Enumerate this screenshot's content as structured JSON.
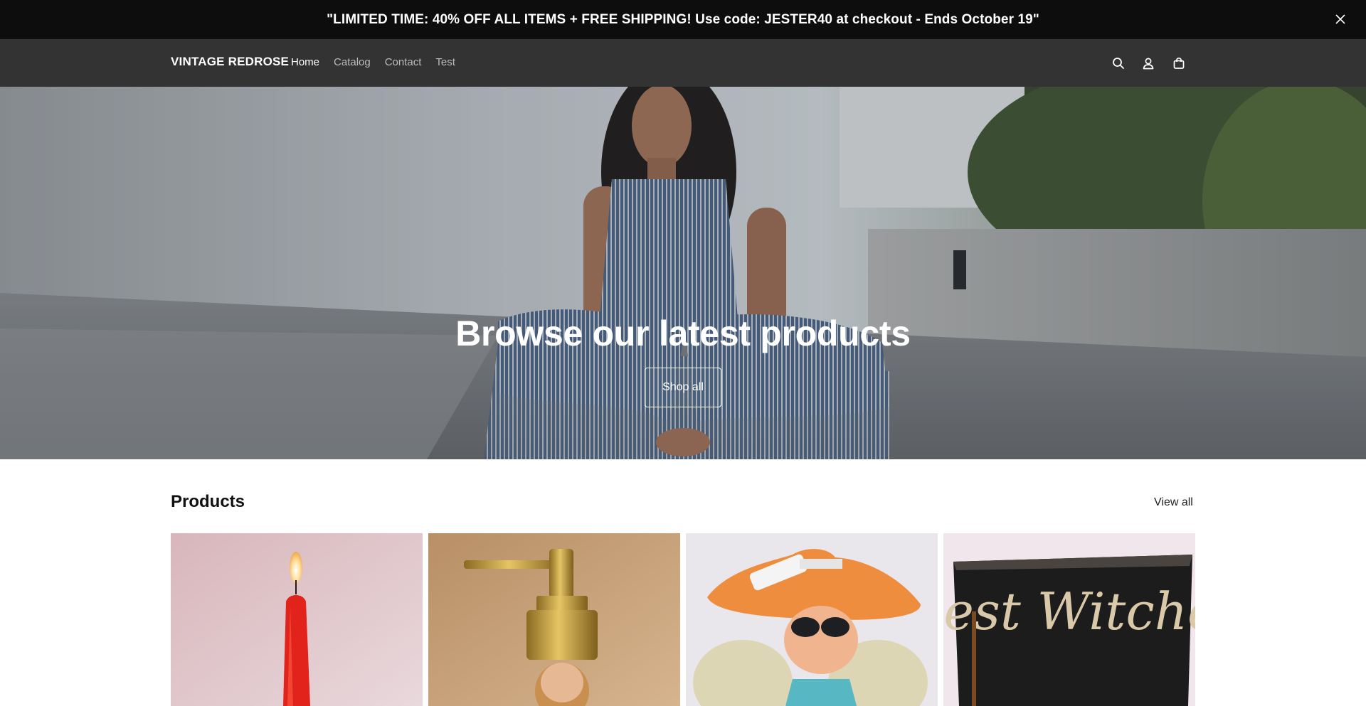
{
  "announcement": {
    "text": "\"LIMITED TIME: 40% OFF ALL ITEMS + FREE SHIPPING! Use code: JESTER40 at checkout - Ends October 19\"",
    "close_icon": "close-icon"
  },
  "header": {
    "logo": "VINTAGE REDROSE",
    "nav": [
      {
        "label": "Home",
        "active": true
      },
      {
        "label": "Catalog",
        "active": false
      },
      {
        "label": "Contact",
        "active": false
      },
      {
        "label": "Test",
        "active": false
      }
    ],
    "icons": [
      "search-icon",
      "account-icon",
      "cart-icon"
    ]
  },
  "hero": {
    "title": "Browse our latest products",
    "button_label": "Shop all"
  },
  "products": {
    "title": "Products",
    "view_all": "View all",
    "items": [
      {
        "image": "red-candle-product-image"
      },
      {
        "image": "soap-dispenser-product-image"
      },
      {
        "image": "fairy-figurine-product-image"
      },
      {
        "image": "best-witches-sign-product-image",
        "image_text": "Best Witches"
      }
    ]
  },
  "colors": {
    "announcement_bg": "#0d0d0d",
    "header_bg": "#333333",
    "page_bg": "#ffffff"
  }
}
